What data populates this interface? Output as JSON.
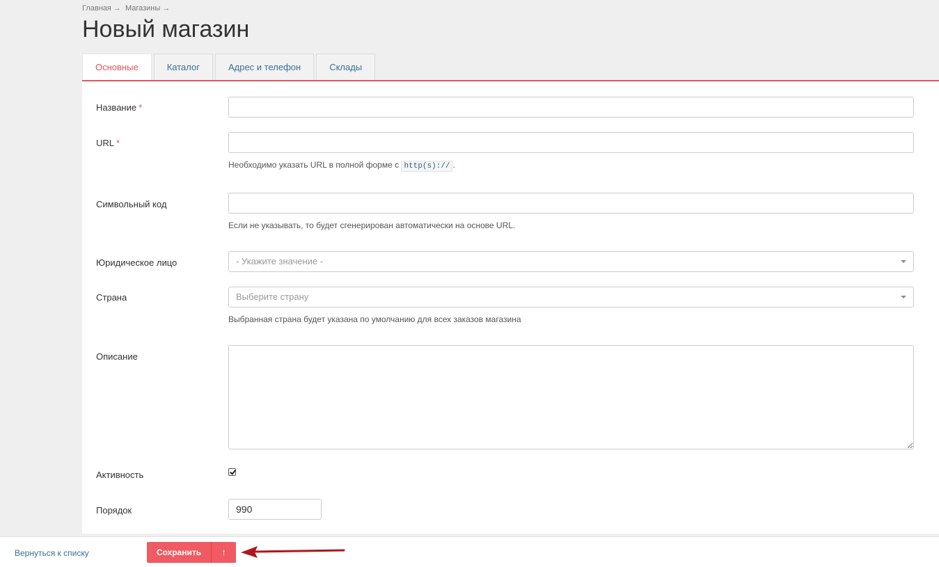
{
  "breadcrumb": {
    "home": "Главная",
    "sep1": "→",
    "section": "Магазины",
    "sep2": "→"
  },
  "title": "Новый магазин",
  "tabs": [
    {
      "label": "Основные"
    },
    {
      "label": "Каталог"
    },
    {
      "label": "Адрес и телефон"
    },
    {
      "label": "Склады"
    }
  ],
  "form": {
    "name": {
      "label": "Название",
      "required_mark": "*",
      "value": ""
    },
    "url": {
      "label": "URL",
      "required_mark": "*",
      "value": "",
      "hint_before": "Необходимо указать URL в полной форме с ",
      "hint_code": "http(s)://",
      "hint_after": "."
    },
    "code": {
      "label": "Символьный код",
      "value": "",
      "hint": "Если не указывать, то будет сгенерирован автоматически на основе URL."
    },
    "legal": {
      "label": "Юридическое лицо",
      "placeholder": "- Укажите значение -"
    },
    "country": {
      "label": "Страна",
      "placeholder": "Выберите страну",
      "hint": "Выбранная страна будет указана по умолчанию для всех заказов магазина"
    },
    "description": {
      "label": "Описание",
      "value": ""
    },
    "active": {
      "label": "Активность",
      "checked": true
    },
    "order": {
      "label": "Порядок",
      "value": "990"
    }
  },
  "footer": {
    "back_label": "Вернуться к списку",
    "save_label": "Сохранить",
    "save_arrow": "↑"
  },
  "colors": {
    "accent": "#ef5a63",
    "link": "#3a6f96",
    "annotation_arrow": "#b0161b"
  },
  "icons": {
    "save_arrow": "arrow-up-icon",
    "dropdown": "chevron-down-icon",
    "annotation": "red-arrow-icon"
  }
}
